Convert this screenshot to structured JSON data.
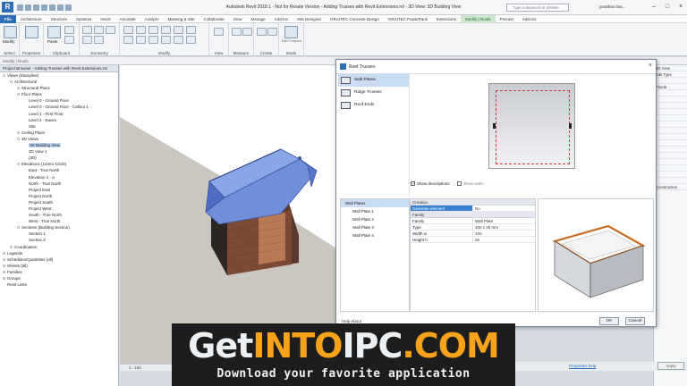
{
  "titlebar": {
    "app_logo": "R",
    "title": "Autodesk Revit 2018.1 - Not for Resale Version -  Adding Trusses with Revit Extensions.rvt - 3D View: 3D Building View",
    "search_placeholder": "Type a keyword or phrase",
    "user": "jonathan.has...",
    "minimize": "–",
    "maximize": "□",
    "close": "×"
  },
  "menu": {
    "tabs": [
      "File",
      "Architecture",
      "Structure",
      "Systems",
      "Insert",
      "Annotate",
      "Analyze",
      "Massing & Site",
      "Collaborate",
      "View",
      "Manage",
      "Add-Ins",
      "Site Designer",
      "GRAITEC Concrete Design",
      "GRAITEC PowerPack",
      "Extensions",
      "Modify | Roofs",
      "Precast",
      "Add-Ins"
    ],
    "active_index": 16
  },
  "ribbon": {
    "groups": [
      "Select",
      "Properties",
      "Clipboard",
      "Geometry",
      "Modify",
      "View",
      "Measure",
      "Create",
      "Mode"
    ],
    "buttons": {
      "modify": "Modify",
      "paste": "Paste",
      "edit_footprint": "Edit Footprint"
    }
  },
  "modify_bar": "Modify | Roofs",
  "project_browser": {
    "title": "Project Browser - Adding Trusses with Revit Extensions.rvt",
    "rows": [
      {
        "label": "Views (Discipline)",
        "depth": 0,
        "toggle": "⊟"
      },
      {
        "label": "Architectural",
        "depth": 1,
        "toggle": "⊟"
      },
      {
        "label": "Structural Plans",
        "depth": 2,
        "toggle": "⊞"
      },
      {
        "label": "Floor Plans",
        "depth": 2,
        "toggle": "⊟"
      },
      {
        "label": "Level 0 - Ground Floor",
        "depth": 3,
        "toggle": ""
      },
      {
        "label": "Level 0 - Ground Floor - Callout 1",
        "depth": 3,
        "toggle": ""
      },
      {
        "label": "Level 1 - First Floor",
        "depth": 3,
        "toggle": ""
      },
      {
        "label": "Level 2 - Eaves",
        "depth": 3,
        "toggle": ""
      },
      {
        "label": "Site",
        "depth": 3,
        "toggle": ""
      },
      {
        "label": "Ceiling Plans",
        "depth": 2,
        "toggle": "⊞"
      },
      {
        "label": "3D Views",
        "depth": 2,
        "toggle": "⊟"
      },
      {
        "label": "3D Building View",
        "depth": 3,
        "toggle": "",
        "selected": true
      },
      {
        "label": "3D View 1",
        "depth": 3,
        "toggle": ""
      },
      {
        "label": "{3D}",
        "depth": 3,
        "toggle": ""
      },
      {
        "label": "Elevations (12mm Circle)",
        "depth": 2,
        "toggle": "⊟"
      },
      {
        "label": "East - True North",
        "depth": 3,
        "toggle": ""
      },
      {
        "label": "Elevation 1 - a",
        "depth": 3,
        "toggle": ""
      },
      {
        "label": "North - True North",
        "depth": 3,
        "toggle": ""
      },
      {
        "label": "Project East",
        "depth": 3,
        "toggle": ""
      },
      {
        "label": "Project North",
        "depth": 3,
        "toggle": ""
      },
      {
        "label": "Project South",
        "depth": 3,
        "toggle": ""
      },
      {
        "label": "Project West",
        "depth": 3,
        "toggle": ""
      },
      {
        "label": "South - True North",
        "depth": 3,
        "toggle": ""
      },
      {
        "label": "West - True North",
        "depth": 3,
        "toggle": ""
      },
      {
        "label": "Sections (Building Section)",
        "depth": 2,
        "toggle": "⊟"
      },
      {
        "label": "Section 1",
        "depth": 3,
        "toggle": ""
      },
      {
        "label": "Section 2",
        "depth": 3,
        "toggle": ""
      },
      {
        "label": "Coordination",
        "depth": 1,
        "toggle": "⊞"
      },
      {
        "label": "Legends",
        "depth": 0,
        "toggle": "⊞"
      },
      {
        "label": "Schedules/Quantities (all)",
        "depth": 0,
        "toggle": "⊞"
      },
      {
        "label": "Sheets (all)",
        "depth": 0,
        "toggle": "⊞"
      },
      {
        "label": "Families",
        "depth": 0,
        "toggle": "⊞"
      },
      {
        "label": "Groups",
        "depth": 0,
        "toggle": "⊞"
      },
      {
        "label": "Revit Links",
        "depth": 0,
        "toggle": ""
      }
    ]
  },
  "view_control": {
    "scale": "1 : 100"
  },
  "properties_panel": {
    "rows": [
      "3D View",
      "Edit Type",
      "",
      "Plumb",
      "",
      "",
      "",
      "",
      "",
      "",
      "",
      "",
      "",
      "",
      "",
      "",
      "",
      "",
      "",
      "Construction"
    ],
    "link": "Properties help",
    "apply": "Apply"
  },
  "dialog": {
    "title": "Roof Trusses",
    "close": "×",
    "types": [
      {
        "label": "Wall Plates",
        "selected": true
      },
      {
        "label": "Ridge Trusses",
        "selected": false
      },
      {
        "label": "Roof Ends",
        "selected": false
      }
    ],
    "show_descriptions": "Show descriptions",
    "show_walls": "Show walls",
    "plates": [
      "Wall Plates",
      "Wall Plate 1",
      "Wall Plate 2",
      "Wall Plate 3",
      "Wall Plate 4"
    ],
    "params": [
      {
        "type": "head",
        "k": "Creation"
      },
      {
        "type": "row",
        "k": "Generate element",
        "v": "No",
        "sel": true
      },
      {
        "type": "head",
        "k": "Family"
      },
      {
        "type": "row",
        "k": "Family",
        "v": "Wall Plate"
      },
      {
        "type": "row",
        "k": "Type",
        "v": "100 x 25 mm"
      },
      {
        "type": "row",
        "k": "Width   w",
        "v": "100"
      },
      {
        "type": "row",
        "k": "Height   h",
        "v": "25"
      }
    ],
    "ok": "OK",
    "cancel": "Cancel",
    "footer": "Help     About"
  },
  "banner": {
    "part1": "Get",
    "part2": "INTO",
    "part3": "IPC",
    "part4": ".COM",
    "subtitle": "Download your favorite application"
  },
  "colors": {
    "revit_blue": "#2d6db5",
    "roof_blue": "#6f8fd9",
    "brick": "#8a4a32",
    "banner_orange": "#f7a21b"
  }
}
